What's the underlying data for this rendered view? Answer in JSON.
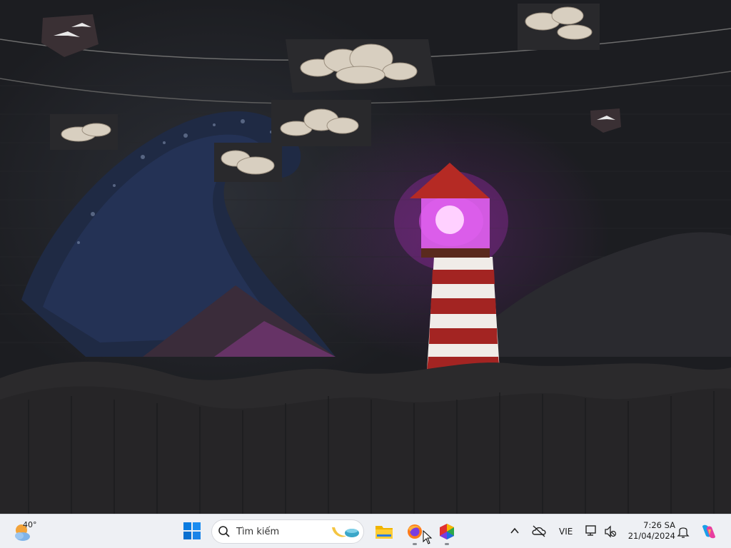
{
  "desktop": {
    "wallpaper": "lighthouse-wave-papercraft",
    "accent_color": "#c040d0"
  },
  "taskbar": {
    "weather": {
      "temperature": "40°",
      "icon": "partly-sunny-icon"
    },
    "start": {
      "icon": "windows-start-icon"
    },
    "search": {
      "placeholder": "Tìm kiếm"
    },
    "pinned_apps": [
      {
        "name": "file-explorer",
        "icon": "folder-icon",
        "running": false
      },
      {
        "name": "firefox",
        "icon": "firefox-icon",
        "running": true
      },
      {
        "name": "colorful-app",
        "icon": "hexagon-app-icon",
        "running": true
      }
    ],
    "tray": {
      "language": "VIE",
      "time": "7:26 SA",
      "date": "21/04/2024"
    }
  }
}
